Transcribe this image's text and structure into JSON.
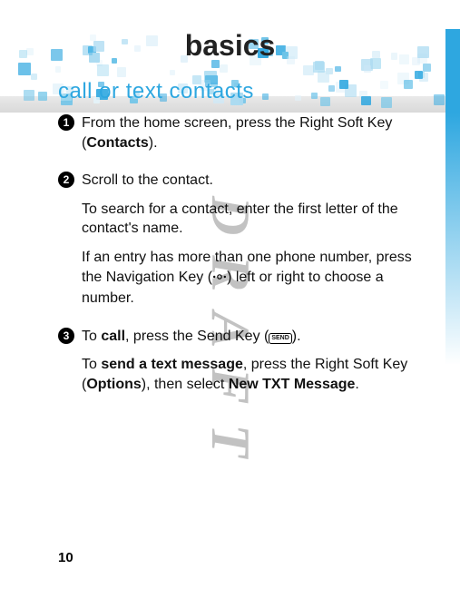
{
  "pageTitle": "basics",
  "sectionTitle": "call or text contacts",
  "watermark": "DRAFT",
  "pageNumber": "10",
  "labels": {
    "contacts": "Contacts",
    "options": "Options",
    "newTxt": "New TXT Message",
    "call": "call",
    "sendText": "send a text message",
    "sendKeyGlyph": "SEND"
  },
  "steps": [
    {
      "num": "1",
      "paras": [
        {
          "fragments": [
            {
              "t": "From the home screen, press the Right Soft Key ("
            },
            {
              "t": "Contacts",
              "cls": "narrow"
            },
            {
              "t": ")."
            }
          ]
        }
      ]
    },
    {
      "num": "2",
      "paras": [
        {
          "fragments": [
            {
              "t": "Scroll to the contact."
            }
          ]
        },
        {
          "fragments": [
            {
              "t": "To search for a contact, enter the first letter of the contact's name."
            }
          ]
        },
        {
          "fragments": [
            {
              "t": "If an entry has more than one phone number, press the Navigation Key ("
            },
            {
              "svg": "nav"
            },
            {
              "t": ") left or right to choose a number."
            }
          ]
        }
      ]
    },
    {
      "num": "3",
      "paras": [
        {
          "fragments": [
            {
              "t": "To "
            },
            {
              "t": "call",
              "cls": "bold"
            },
            {
              "t": ", press the Send Key ("
            },
            {
              "svg": "send"
            },
            {
              "t": ")."
            }
          ]
        },
        {
          "fragments": [
            {
              "t": "To "
            },
            {
              "t": "send a text message",
              "cls": "bold"
            },
            {
              "t": ", press the Right Soft Key ("
            },
            {
              "t": "Options",
              "cls": "narrow"
            },
            {
              "t": "), then select "
            },
            {
              "t": "New TXT Message",
              "cls": "narrow"
            },
            {
              "t": "."
            }
          ]
        }
      ]
    }
  ]
}
